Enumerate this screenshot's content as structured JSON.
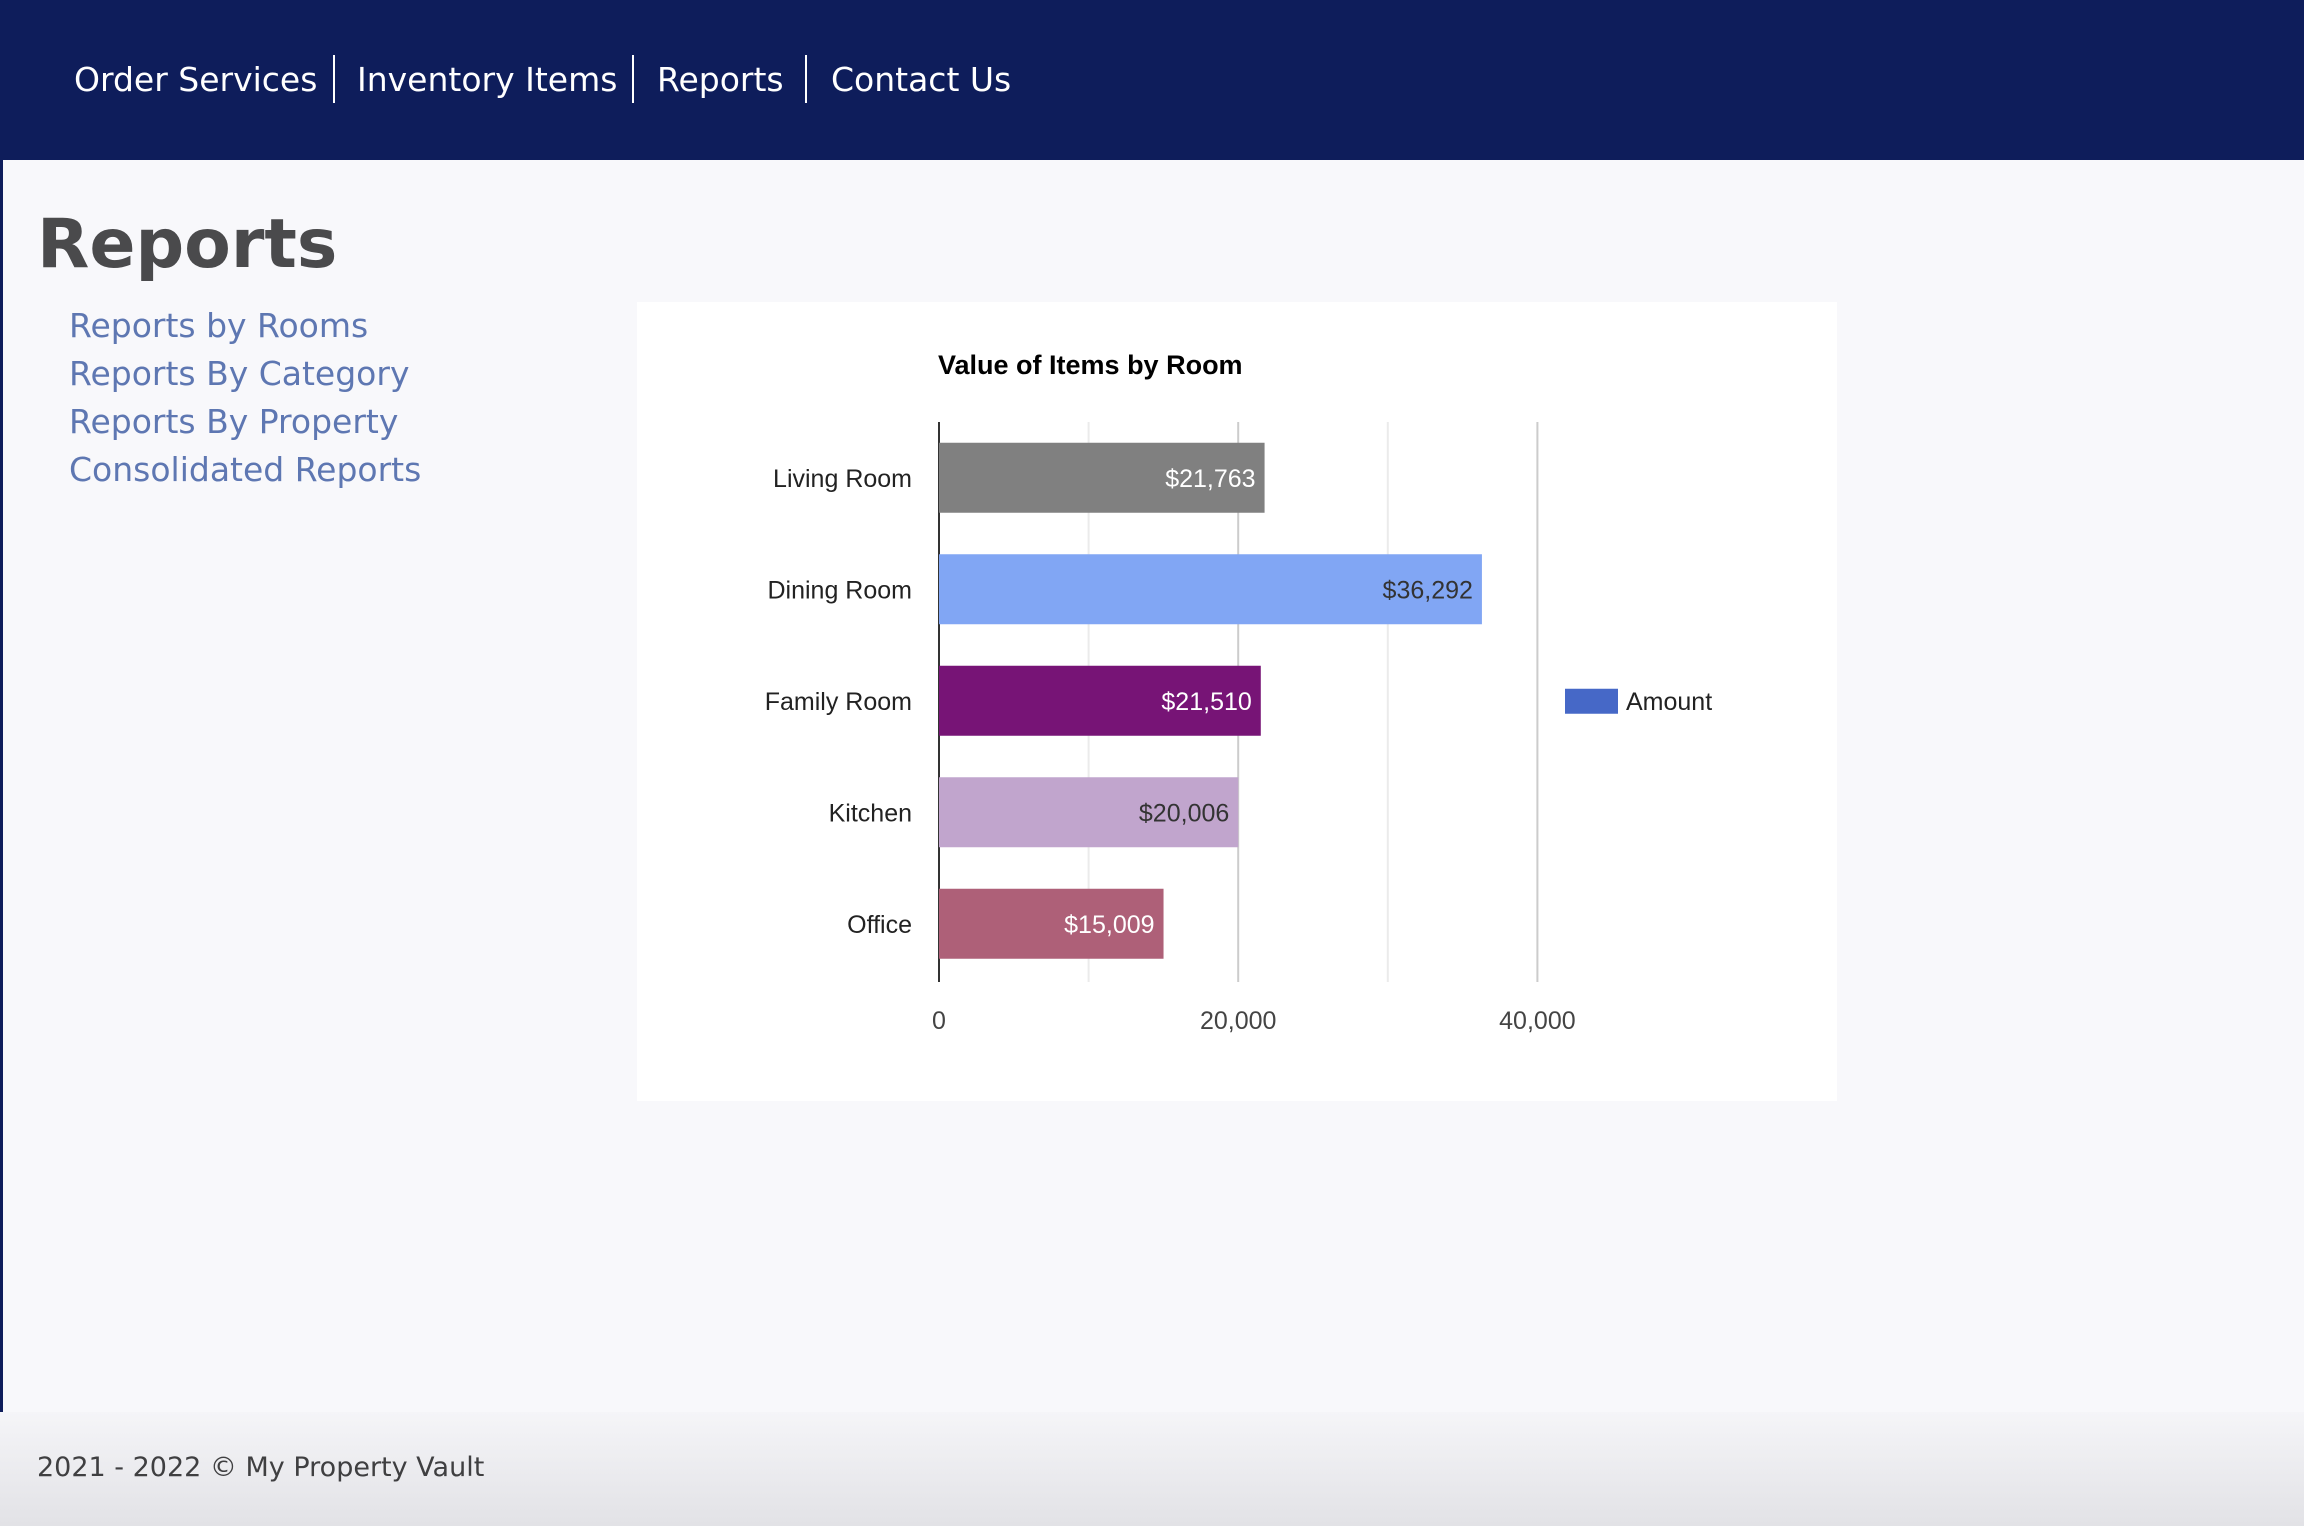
{
  "nav": {
    "items": [
      {
        "label": "Order Services"
      },
      {
        "label": "Inventory Items"
      },
      {
        "label": "Reports"
      },
      {
        "label": "Contact Us"
      }
    ]
  },
  "page": {
    "title": "Reports"
  },
  "sidebar": {
    "links": [
      {
        "label": "Reports by Rooms"
      },
      {
        "label": "Reports By Category"
      },
      {
        "label": "Reports By Property"
      },
      {
        "label": "Consolidated Reports"
      }
    ]
  },
  "chart_data": {
    "type": "bar",
    "orientation": "horizontal",
    "title": "Value of Items by Room",
    "categories": [
      "Living Room",
      "Dining Room",
      "Family Room",
      "Kitchen",
      "Office"
    ],
    "series": [
      {
        "name": "Amount",
        "values": [
          21763,
          36292,
          21510,
          20006,
          15009
        ]
      }
    ],
    "data_labels": [
      "$21,763",
      "$36,292",
      "$21,510",
      "$20,006",
      "$15,009"
    ],
    "bar_colors": [
      "#808080",
      "#81a6f4",
      "#771476",
      "#c1a5cd",
      "#ae6078"
    ],
    "label_colors": [
      "#ffffff",
      "#333333",
      "#ffffff",
      "#333333",
      "#ffffff"
    ],
    "legend_color": "#4668c7",
    "xlim": [
      0,
      50000
    ],
    "xticks": [
      0,
      20000,
      40000
    ],
    "xtick_labels": [
      "0",
      "20,000",
      "40,000"
    ],
    "minor_gridlines": [
      10000,
      30000
    ],
    "grid": true,
    "legend_position": "right",
    "xlabel": "",
    "ylabel": ""
  },
  "footer": {
    "text": "2021 - 2022 © My Property Vault"
  }
}
